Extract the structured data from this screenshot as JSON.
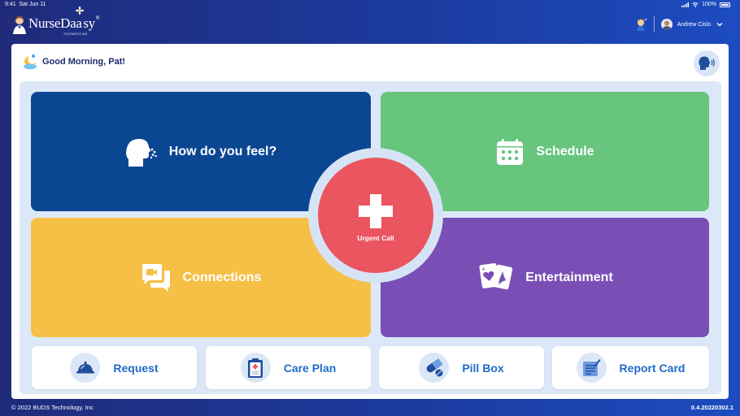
{
  "status_bar": {
    "time": "9:41",
    "date": "Sat Jun 11",
    "battery": "100%"
  },
  "brand": {
    "name_part1": "NurseDa",
    "name_part2": "sy",
    "registered": "®",
    "tagline": "TELEMEDICINE"
  },
  "user": {
    "name": "Andrew Cislo"
  },
  "greeting": "Good Morning, Pat!",
  "tiles": {
    "feel": "How do you feel?",
    "schedule": "Schedule",
    "connections": "Connections",
    "entertainment": "Entertainment",
    "urgent": "Urgent Call"
  },
  "actions": {
    "request": "Request",
    "care_plan": "Care Plan",
    "pill_box": "Pill Box",
    "report_card": "Report Card"
  },
  "footer": {
    "copyright": "© 2022 BUDS Technology, Inc",
    "version": "0.4.20220302.1"
  },
  "colors": {
    "feel": "#0b4693",
    "schedule": "#67c57e",
    "connections": "#f6bf45",
    "entertainment": "#7a4fb5",
    "urgent": "#ea5560",
    "accent": "#1e6bc9"
  },
  "icons": {
    "feel": "sneeze-icon",
    "schedule": "calendar-icon",
    "connections": "chat-video-icon",
    "entertainment": "playing-cards-icon",
    "urgent": "plus-cross-icon",
    "request": "service-bell-icon",
    "care_plan": "clipboard-icon",
    "pill_box": "pill-icon",
    "report_card": "report-icon"
  }
}
